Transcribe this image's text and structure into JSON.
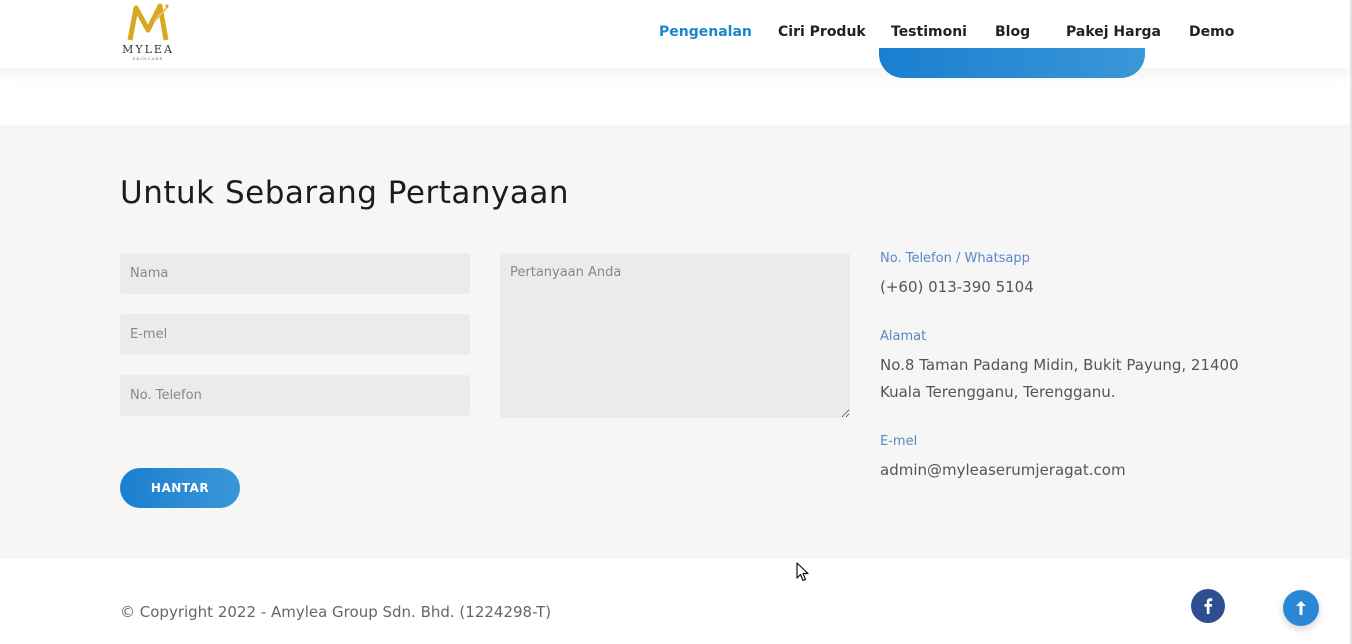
{
  "brand": {
    "name": "MYLEA",
    "tagline": "SKINCARE",
    "gold": "#d9a823"
  },
  "nav": {
    "items": [
      {
        "label": "Pengenalan",
        "active": true
      },
      {
        "label": "Ciri Produk",
        "active": false
      },
      {
        "label": "Testimoni",
        "active": false
      },
      {
        "label": "Blog",
        "active": false
      },
      {
        "label": "Pakej Harga",
        "active": false
      },
      {
        "label": "Demo",
        "active": false
      }
    ]
  },
  "contact": {
    "title": "Untuk Sebarang Pertanyaan",
    "form": {
      "name_placeholder": "Nama",
      "email_placeholder": "E-mel",
      "phone_placeholder": "No. Telefon",
      "question_placeholder": "Pertanyaan Anda",
      "submit_label": "HANTAR"
    },
    "info": {
      "phone_label": "No. Telefon / Whatsapp",
      "phone_value": "(+60) 013-390 5104",
      "address_label": "Alamat",
      "address_line1": "No.8 Taman Padang Midin, Bukit Payung, 21400",
      "address_line2": "Kuala Terengganu, Terengganu.",
      "email_label": "E-mel",
      "email_value": "admin@myleaserumjeragat.com"
    }
  },
  "footer": {
    "copyright": "© Copyright 2022 - Amylea Group Sdn. Bhd. (1224298-T)",
    "facebook_icon": "facebook-icon",
    "back_to_top_icon": "arrow-up-icon"
  },
  "colors": {
    "accent": "#1b86c9",
    "button": "#2a87d6",
    "facebook": "#2e4e91",
    "section_bg": "#f6f6f6",
    "field_bg": "#ebebeb"
  }
}
